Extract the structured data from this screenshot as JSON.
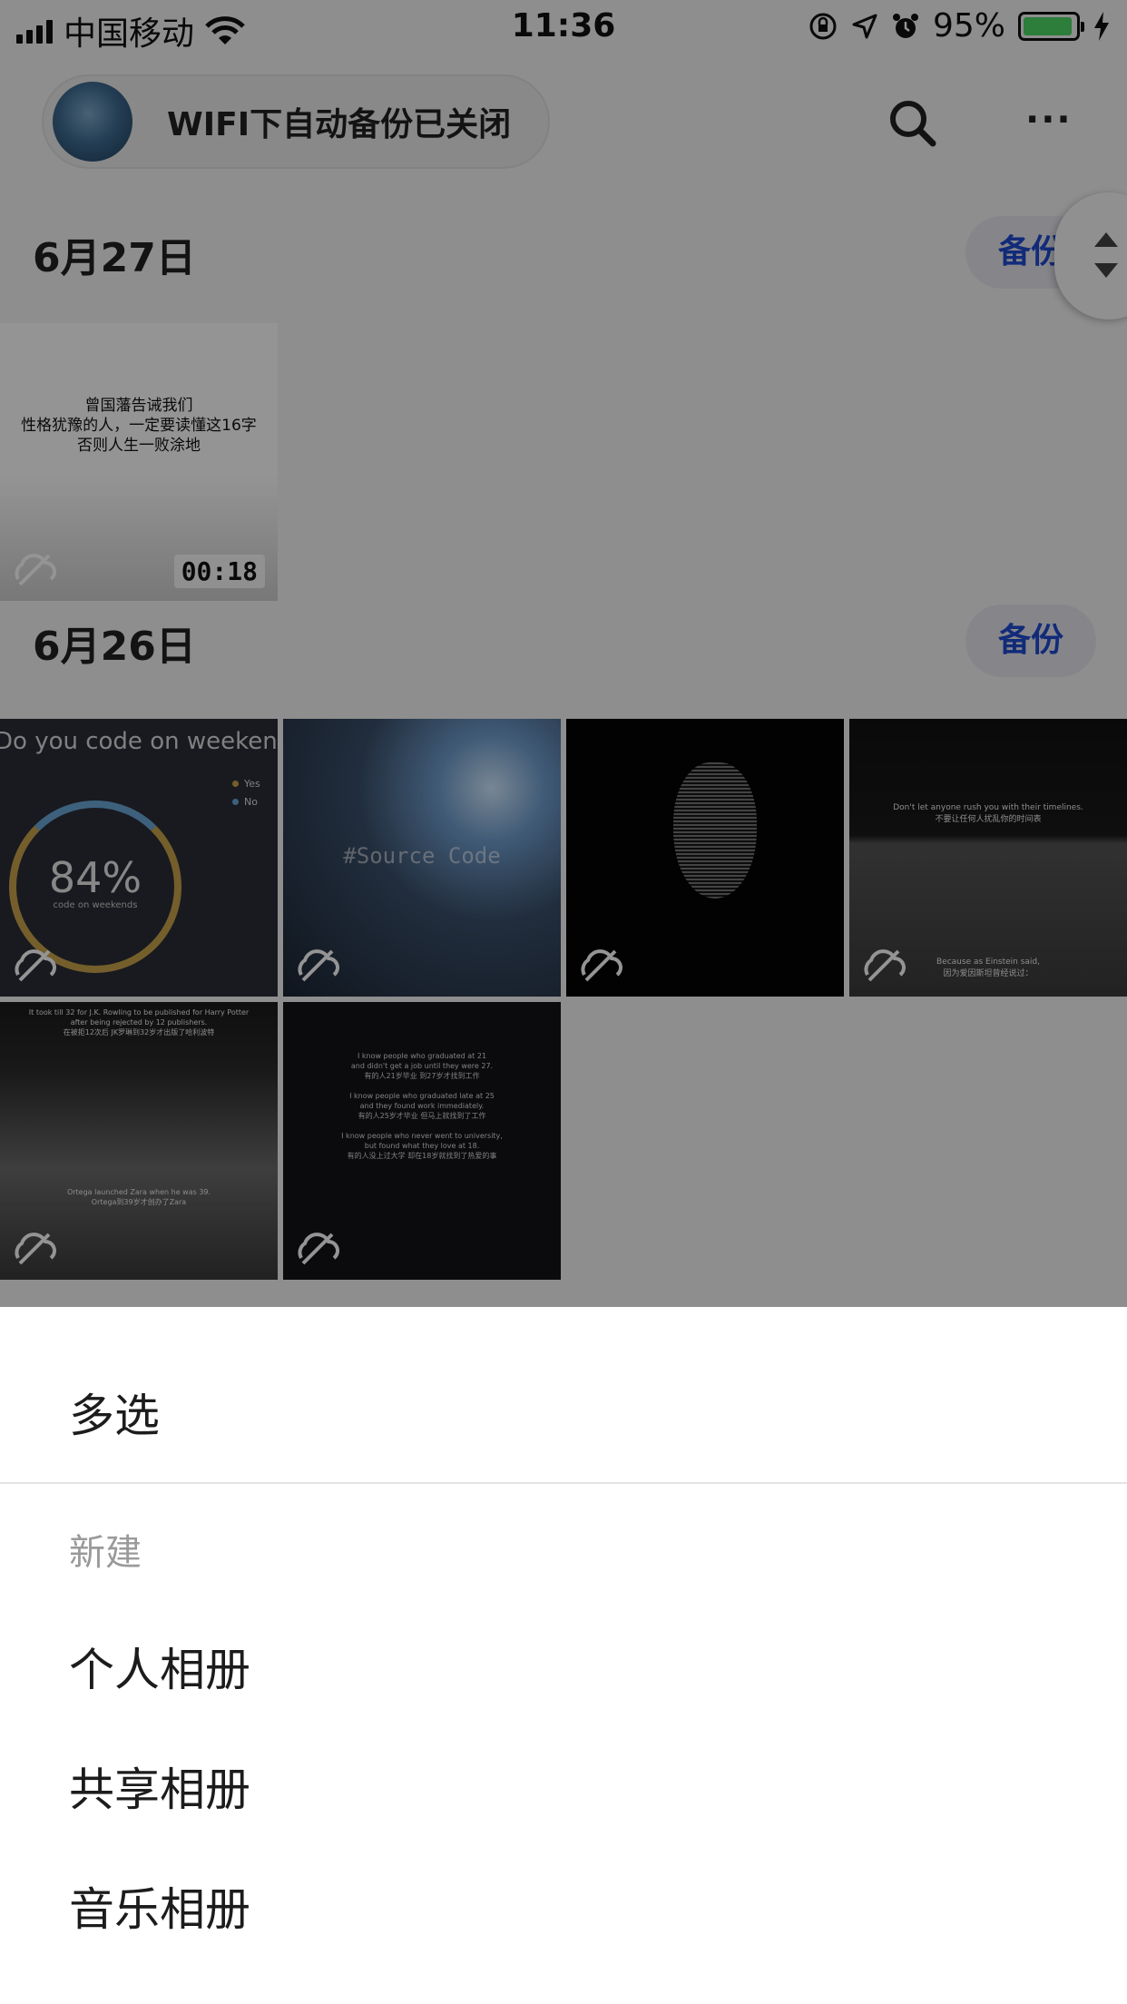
{
  "status_bar": {
    "carrier": "中国移动",
    "time": "11:36",
    "battery_percent": "95%",
    "battery_level": 0.95,
    "battery_color": "#4cd964",
    "icons": [
      "signal-icon",
      "wifi-icon",
      "orientation-lock-icon",
      "location-icon",
      "alarm-icon",
      "battery-icon",
      "charging-icon"
    ]
  },
  "header": {
    "backup_status": "WIFI下自动备份已关闭",
    "search_icon": "search-icon",
    "more_label": "···"
  },
  "sections": [
    {
      "date": "6月27日",
      "backup_label": "备份",
      "items": [
        {
          "caption": "曾国藩告诫我们\n性格犹豫的人，一定要读懂这16字\n否则人生一败涂地",
          "duration": "00:18"
        }
      ]
    },
    {
      "date": "6月26日",
      "backup_label": "备份",
      "items": [
        {
          "title": "Do you code on weekends",
          "value": "84%",
          "sub": "code on weekends",
          "legend": [
            "Yes",
            "No"
          ]
        },
        {
          "caption": "#Source Code"
        },
        {
          "caption": ""
        },
        {
          "caption": "Don't let anyone rush you with their timelines.\n不要让任何人扰乱你的时间表",
          "caption2": "Because as Einstein said,\n因为爱因斯坦曾经说过："
        },
        {
          "caption": "It took till 32 for J.K. Rowling to be published for Harry Potter\nafter being rejected by 12 publishers.\n在被拒12次后 JK罗琳到32岁才出版了哈利波特",
          "caption2": "Ortega launched Zara when he was 39.\nOrtega到39岁才创办了Zara"
        },
        {
          "caption": "I know people who graduated at 21\nand didn't get a job until they were 27.\n有的人21岁毕业 到27岁才找到工作\n\nI know people who graduated late at 25\nand they found work immediately.\n有的人25岁才毕业 但马上就找到了工作\n\nI know people who never went to university,\nbut found what they love at 18.\n有的人没上过大学 却在18岁就找到了热爱的事"
        }
      ]
    }
  ],
  "action_sheet": {
    "multi_select": "多选",
    "new_section": "新建",
    "options": [
      "个人相册",
      "共享相册",
      "音乐相册"
    ]
  },
  "colors": {
    "accent": "#1f4bd1",
    "overlay": "rgba(0,0,0,0.42)"
  }
}
